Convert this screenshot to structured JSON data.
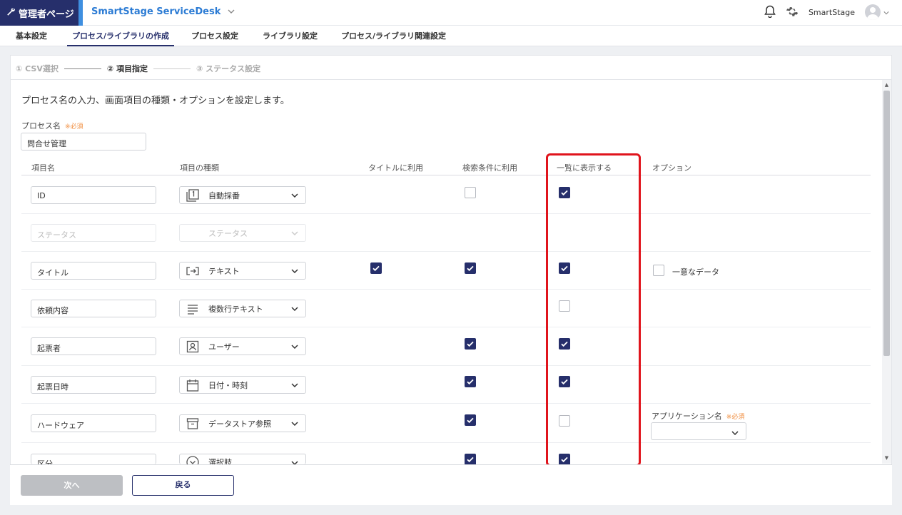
{
  "header": {
    "admin_label": "管理者ページ",
    "app_title": "SmartStage ServiceDesk",
    "user_name": "SmartStage"
  },
  "tabs": [
    {
      "label": "基本設定",
      "active": false
    },
    {
      "label": "プロセス/ライブラリの作成",
      "active": true
    },
    {
      "label": "プロセス設定",
      "active": false
    },
    {
      "label": "ライブラリ設定",
      "active": false
    },
    {
      "label": "プロセス/ライブラリ関連設定",
      "active": false
    }
  ],
  "stepper": {
    "step1": "① CSV選択",
    "step2": "② 項目指定",
    "step3": "③ ステータス設定"
  },
  "description": "プロセス名の入力、画面項目の種類・オプションを設定します。",
  "process_name": {
    "label": "プロセス名",
    "required": "※必須",
    "value": "問合せ管理"
  },
  "table": {
    "headers": {
      "item_name": "項目名",
      "item_type": "項目の種類",
      "use_title": "タイトルに利用",
      "use_search": "検索条件に利用",
      "show_list": "一覧に表示する",
      "option": "オプション"
    },
    "rows": [
      {
        "name": "ID",
        "type": "自動採番",
        "icon": "auto-number-icon",
        "disabled": false,
        "title": null,
        "search": false,
        "list": true
      },
      {
        "name": "ステータス",
        "type": "ステータス",
        "icon": "",
        "disabled": true,
        "title": null,
        "search": null,
        "list": null
      },
      {
        "name": "タイトル",
        "type": "テキスト",
        "icon": "text-icon",
        "disabled": false,
        "title": true,
        "search": true,
        "list": true
      },
      {
        "name": "依頼内容",
        "type": "複数行テキスト",
        "icon": "multiline-text-icon",
        "disabled": false,
        "title": null,
        "search": null,
        "list": false
      },
      {
        "name": "起票者",
        "type": "ユーザー",
        "icon": "user-icon",
        "disabled": false,
        "title": null,
        "search": true,
        "list": true
      },
      {
        "name": "起票日時",
        "type": "日付・時刻",
        "icon": "calendar-icon",
        "disabled": false,
        "title": null,
        "search": true,
        "list": true
      },
      {
        "name": "ハードウェア",
        "type": "データストア参照",
        "icon": "datastore-icon",
        "disabled": false,
        "title": null,
        "search": true,
        "list": false
      },
      {
        "name": "区分",
        "type": "選択肢",
        "icon": "choice-icon",
        "disabled": false,
        "title": null,
        "search": true,
        "list": true
      }
    ],
    "options": {
      "unique_data": "一意なデータ",
      "app_name_label": "アプリケーション名",
      "app_name_required": "※必須",
      "app_name_value": ""
    }
  },
  "footer": {
    "next": "次へ",
    "back": "戻る"
  },
  "colors": {
    "brand": "#262f6b",
    "accent": "#2b7bd4",
    "required": "#f08c3c",
    "highlight": "#e0141c"
  }
}
